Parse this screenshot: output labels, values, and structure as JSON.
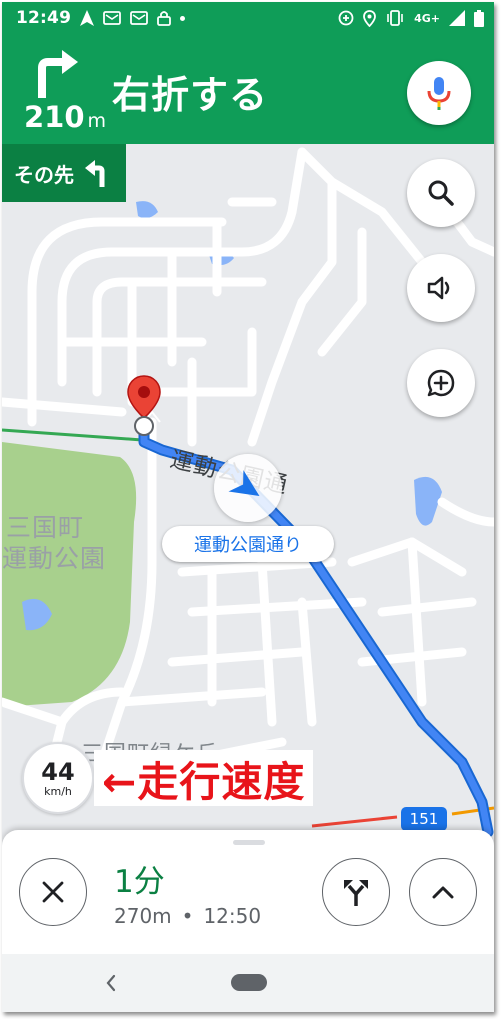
{
  "status_bar": {
    "time": "12:49",
    "left_icons": [
      "navigation-icon",
      "gmail-icon",
      "gmail-icon",
      "lock-icon",
      "dot-icon"
    ],
    "right_icons": [
      "data-saver-icon",
      "location-icon",
      "vibrate-icon",
      "signal-icon",
      "battery-icon"
    ],
    "network": "4G+"
  },
  "navigation": {
    "distance_value": "210",
    "distance_unit": "m",
    "instruction": "右折する",
    "turn_icon": "turn-right-icon",
    "then_label": "その先",
    "then_icon": "turn-left-icon"
  },
  "colors": {
    "header_green": "#0f9d58",
    "then_green": "#0b8043",
    "route_blue": "#4285f4",
    "annotation_red": "#e8141a",
    "park_green": "#a8d08d"
  },
  "map": {
    "park_name_line1": "三国町",
    "park_name_line2": "運動公園",
    "district_label": "三国町緑ケ丘",
    "road_label_main": "運動公園通",
    "road_chip": "運動公園通り",
    "route_number": "151"
  },
  "map_buttons": [
    "search-icon",
    "volume-icon",
    "add-report-icon"
  ],
  "speedometer": {
    "value": "44",
    "unit": "km/h"
  },
  "annotation": "←走行速度",
  "trip": {
    "duration": "1分",
    "distance": "270m",
    "separator": "•",
    "arrival_time": "12:50"
  }
}
